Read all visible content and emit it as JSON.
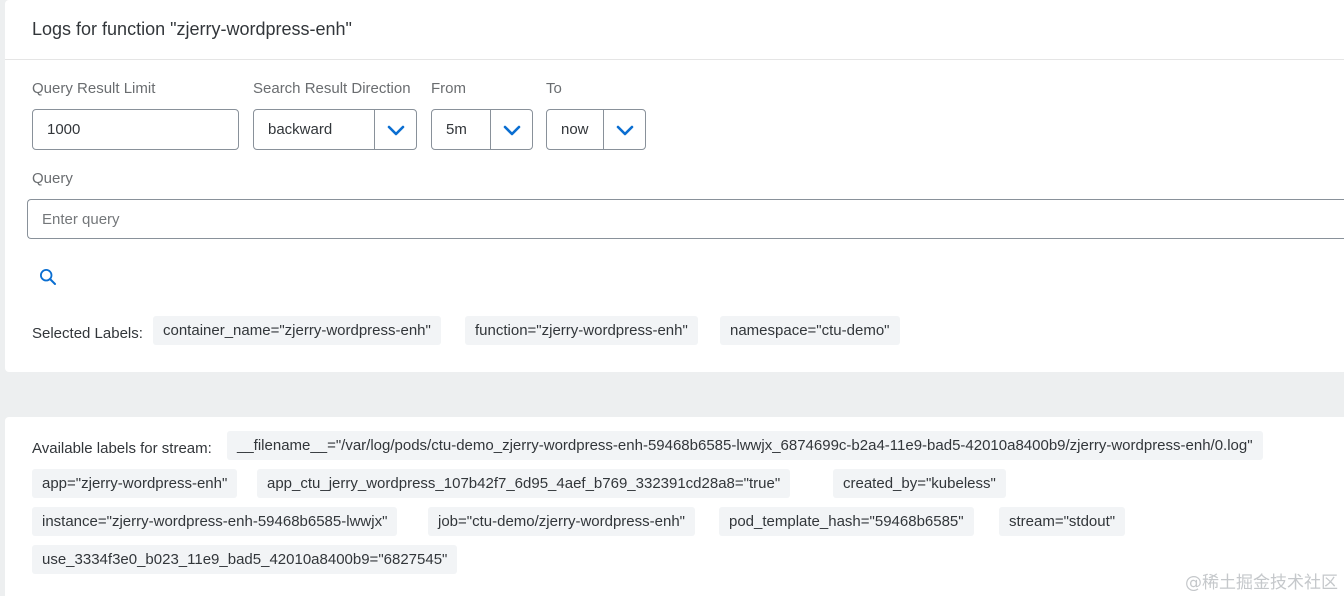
{
  "header": {
    "title": "Logs for function \"zjerry-wordpress-enh\""
  },
  "form": {
    "query_limit": {
      "label": "Query Result Limit",
      "value": "1000"
    },
    "direction": {
      "label": "Search Result Direction",
      "value": "backward"
    },
    "from": {
      "label": "From",
      "value": "5m"
    },
    "to": {
      "label": "To",
      "value": "now"
    },
    "query": {
      "label": "Query",
      "placeholder": "Enter query"
    }
  },
  "selected_labels": {
    "label": "Selected Labels:",
    "items": [
      "container_name=\"zjerry-wordpress-enh\"",
      "function=\"zjerry-wordpress-enh\"",
      "namespace=\"ctu-demo\""
    ]
  },
  "available_labels": {
    "label": "Available labels for stream:",
    "items": [
      "__filename__=\"/var/log/pods/ctu-demo_zjerry-wordpress-enh-59468b6585-lwwjx_6874699c-b2a4-11e9-bad5-42010a8400b9/zjerry-wordpress-enh/0.log\"",
      "app=\"zjerry-wordpress-enh\"",
      "app_ctu_jerry_wordpress_107b42f7_6d95_4aef_b769_332391cd28a8=\"true\"",
      "created_by=\"kubeless\"",
      "instance=\"zjerry-wordpress-enh-59468b6585-lwwjx\"",
      "job=\"ctu-demo/zjerry-wordpress-enh\"",
      "pod_template_hash=\"59468b6585\"",
      "stream=\"stdout\"",
      "use_3334f3e0_b023_11e9_bad5_42010a8400b9=\"6827545\""
    ]
  },
  "watermark": "@稀土掘金技术社区",
  "colors": {
    "accent": "#0a6ed1",
    "border": "#89919a",
    "chip_bg": "#f2f4f6",
    "page_bg": "#edeff0"
  },
  "icons": {
    "dropdown": "chevron-down-icon",
    "search": "search-icon"
  }
}
